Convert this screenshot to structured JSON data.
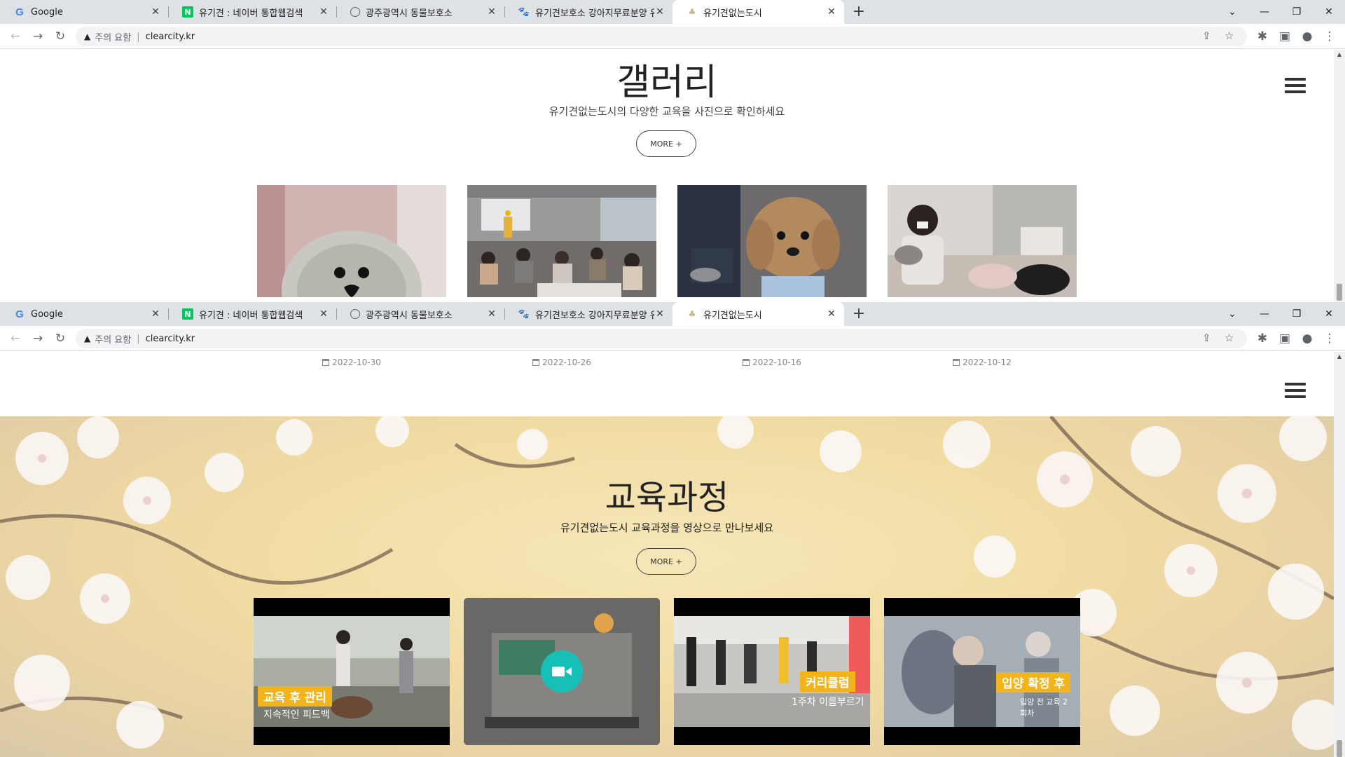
{
  "browser": {
    "tabs": [
      {
        "label": "Google",
        "icon": "google-icon"
      },
      {
        "label": "유기견 : 네이버 통합웹검색",
        "icon": "naver-icon"
      },
      {
        "label": "광주광역시 동물보호소",
        "icon": "globe-icon"
      },
      {
        "label": "유기견보호소 강아지무료분양 유",
        "icon": "paw-icon"
      },
      {
        "label": "유기견없는도시",
        "icon": "site-icon"
      }
    ],
    "security_label": "주의 요함",
    "url": "clearcity.kr"
  },
  "gallery": {
    "title": "갤러리",
    "subtitle": "유기견없는도시의 다양한 교육을 사진으로 확인하세요",
    "more_label": "MORE +",
    "items": [
      {
        "date": "2022-10-30"
      },
      {
        "date": "2022-10-26"
      },
      {
        "date": "2022-10-16"
      },
      {
        "date": "2022-10-12"
      }
    ]
  },
  "education": {
    "title": "교육과정",
    "subtitle": "유기견없는도시 교육과정을 영상으로 만나보세요",
    "more_label": "MORE +",
    "videos": [
      {
        "caption": "교육 후 관리",
        "sub": "지속적인 피드백"
      },
      {
        "caption": "",
        "sub": ""
      },
      {
        "caption": "커리큘럼",
        "sub": "1주차 이름부르기"
      },
      {
        "caption": "입양 확정 후",
        "sub": "입양 전 교육 2회차"
      }
    ]
  }
}
